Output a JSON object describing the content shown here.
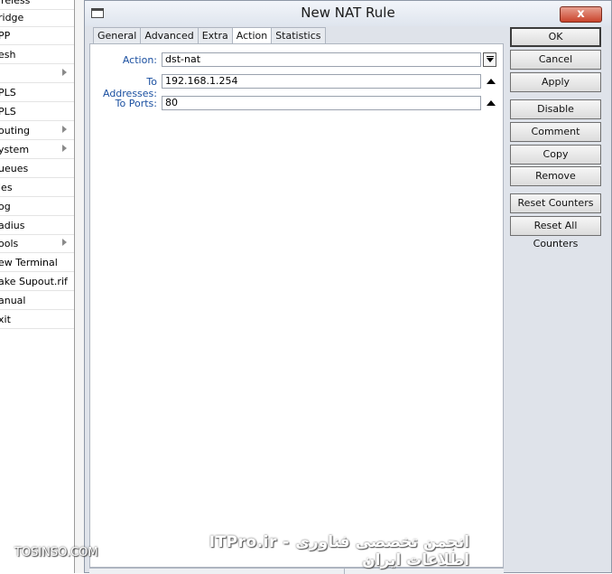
{
  "sidebar": {
    "items": [
      {
        "label": "ireless",
        "has_submenu": false
      },
      {
        "label": "ridge",
        "has_submenu": false
      },
      {
        "label": "PP",
        "has_submenu": false
      },
      {
        "label": "esh",
        "has_submenu": false
      },
      {
        "label": "",
        "has_submenu": true
      },
      {
        "label": "PLS",
        "has_submenu": false
      },
      {
        "label": "PLS",
        "has_submenu": false
      },
      {
        "label": "outing",
        "has_submenu": true
      },
      {
        "label": "ystem",
        "has_submenu": true
      },
      {
        "label": "ueues",
        "has_submenu": false
      },
      {
        "label": "les",
        "has_submenu": false
      },
      {
        "label": "og",
        "has_submenu": false
      },
      {
        "label": "adius",
        "has_submenu": false
      },
      {
        "label": "ools",
        "has_submenu": true
      },
      {
        "label": "ew Terminal",
        "has_submenu": false
      },
      {
        "label": "ake Supout.rif",
        "has_submenu": false
      },
      {
        "label": "anual",
        "has_submenu": false
      },
      {
        "label": "xit",
        "has_submenu": false
      }
    ]
  },
  "window": {
    "title": "New NAT Rule",
    "icon": "window-icon",
    "close_label": "x"
  },
  "tabs": [
    {
      "label": "General",
      "active": false
    },
    {
      "label": "Advanced",
      "active": false
    },
    {
      "label": "Extra",
      "active": false
    },
    {
      "label": "Action",
      "active": true
    },
    {
      "label": "Statistics",
      "active": false
    }
  ],
  "form": {
    "action": {
      "label": "Action:",
      "value": "dst-nat"
    },
    "to_addresses": {
      "label": "To Addresses:",
      "value": "192.168.1.254"
    },
    "to_ports": {
      "label": "To Ports:",
      "value": "80"
    }
  },
  "buttons": {
    "ok": "OK",
    "cancel": "Cancel",
    "apply": "Apply",
    "disable": "Disable",
    "comment": "Comment",
    "copy": "Copy",
    "remove": "Remove",
    "reset_counters": "Reset Counters",
    "reset_all_counters": "Reset All Counters"
  },
  "watermark": {
    "right": "ITPro.ir - انجمن تخصصی فناوری اطلاعات ایران",
    "left": "TOSINSO.COM"
  },
  "colors": {
    "field_label": "#1a4fa0",
    "window_background": "#dfe3ea",
    "close_button": "#c9442c"
  }
}
